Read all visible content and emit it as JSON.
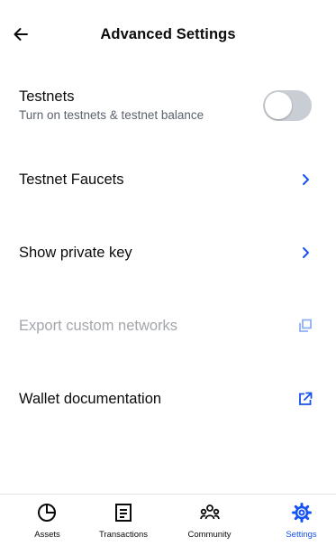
{
  "header": {
    "title": "Advanced Settings",
    "back_icon": "arrow-left-icon"
  },
  "testnets": {
    "label": "Testnets",
    "description": "Turn on testnets & testnet balance",
    "enabled": false
  },
  "rows": [
    {
      "label": "Testnet Faucets",
      "icon": "chevron-right-icon",
      "disabled": false
    },
    {
      "label": "Show private key",
      "icon": "chevron-right-icon",
      "disabled": false
    },
    {
      "label": "Export custom networks",
      "icon": "copy-icon",
      "disabled": true
    },
    {
      "label": "Wallet documentation",
      "icon": "external-link-icon",
      "disabled": false
    }
  ],
  "nav": {
    "items": [
      {
        "label": "Assets",
        "icon": "pie-chart-icon",
        "active": false
      },
      {
        "label": "Transactions",
        "icon": "document-icon",
        "active": false
      },
      {
        "label": "Community",
        "icon": "people-icon",
        "active": false
      },
      {
        "label": "Settings",
        "icon": "gear-icon",
        "active": true
      }
    ]
  },
  "colors": {
    "accent": "#1652f0",
    "text": "#0a0b0d",
    "muted": "#5b616e",
    "disabled": "#a3a6ab",
    "toggle_off": "#c9cdd4"
  }
}
